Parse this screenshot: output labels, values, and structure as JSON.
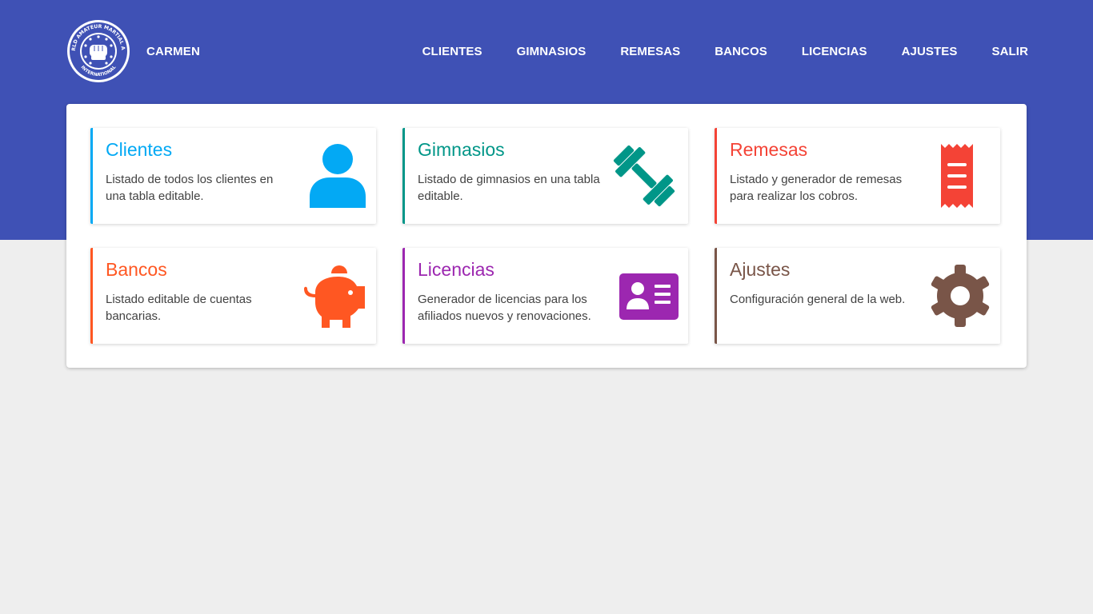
{
  "header": {
    "logo_text_top": "WORLD AMATEUR MARTIAL ARTS",
    "logo_text_bottom": "INTERNATIONAL",
    "username": "CARMEN"
  },
  "nav": [
    {
      "label": "CLIENTES"
    },
    {
      "label": "GIMNASIOS"
    },
    {
      "label": "REMESAS"
    },
    {
      "label": "BANCOS"
    },
    {
      "label": "LICENCIAS"
    },
    {
      "label": "AJUSTES"
    },
    {
      "label": "SALIR"
    }
  ],
  "colors": {
    "header": "#3f51b5",
    "background": "#eeeeee"
  },
  "cards": [
    {
      "title": "Clientes",
      "description": "Listado de todos los clientes en una tabla editable.",
      "icon": "user-icon",
      "color": "#03a9f4"
    },
    {
      "title": "Gimnasios",
      "description": "Listado de gimnasios en una tabla editable.",
      "icon": "dumbbell-icon",
      "color": "#009688"
    },
    {
      "title": "Remesas",
      "description": "Listado y generador de remesas para realizar los cobros.",
      "icon": "receipt-icon",
      "color": "#f44336"
    },
    {
      "title": "Bancos",
      "description": "Listado editable de cuentas bancarias.",
      "icon": "piggy-bank-icon",
      "color": "#ff5722"
    },
    {
      "title": "Licencias",
      "description": "Generador de licencias para los afiliados nuevos y renovaciones.",
      "icon": "id-card-icon",
      "color": "#9c27b0"
    },
    {
      "title": "Ajustes",
      "description": "Configuración general de la web.",
      "icon": "gear-icon",
      "color": "#795548"
    }
  ]
}
